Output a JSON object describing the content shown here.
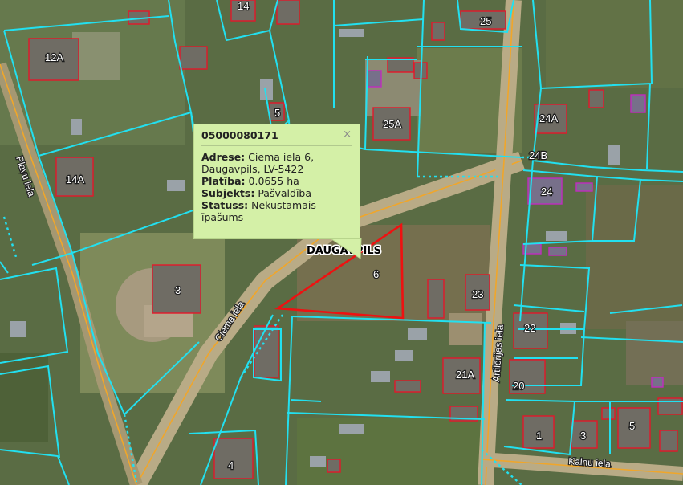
{
  "map": {
    "city_label": "DAUGAVPILS",
    "selected_parcel_number": "6",
    "parcel_labels": [
      "14",
      "25",
      "12A",
      "5",
      "25A",
      "24A",
      "24B",
      "14A",
      "24",
      "3",
      "6",
      "23",
      "22",
      "21A",
      "20",
      "1",
      "3",
      "5",
      "4"
    ],
    "street_labels": [
      "Plavu iela",
      "Ciema iela",
      "Artilērijas iela",
      "Kalnu iela"
    ],
    "colors": {
      "parcel_boundary": "#22e0f0",
      "building_outline": "#e4182a",
      "selection": "#ee1111",
      "road_line": "#f0a62a",
      "popup_bg": "#d4f0a7"
    }
  },
  "popup": {
    "title": "05000080171",
    "close_icon": "×",
    "fields": [
      {
        "label": "Adrese:",
        "value": "Ciema iela 6, Daugavpils, LV-5422"
      },
      {
        "label": "Platība:",
        "value": "0.0655 ha"
      },
      {
        "label": "Subjekts:",
        "value": "Pašvaldība"
      },
      {
        "label": "Statuss:",
        "value": "Nekustamais īpašums"
      }
    ]
  }
}
